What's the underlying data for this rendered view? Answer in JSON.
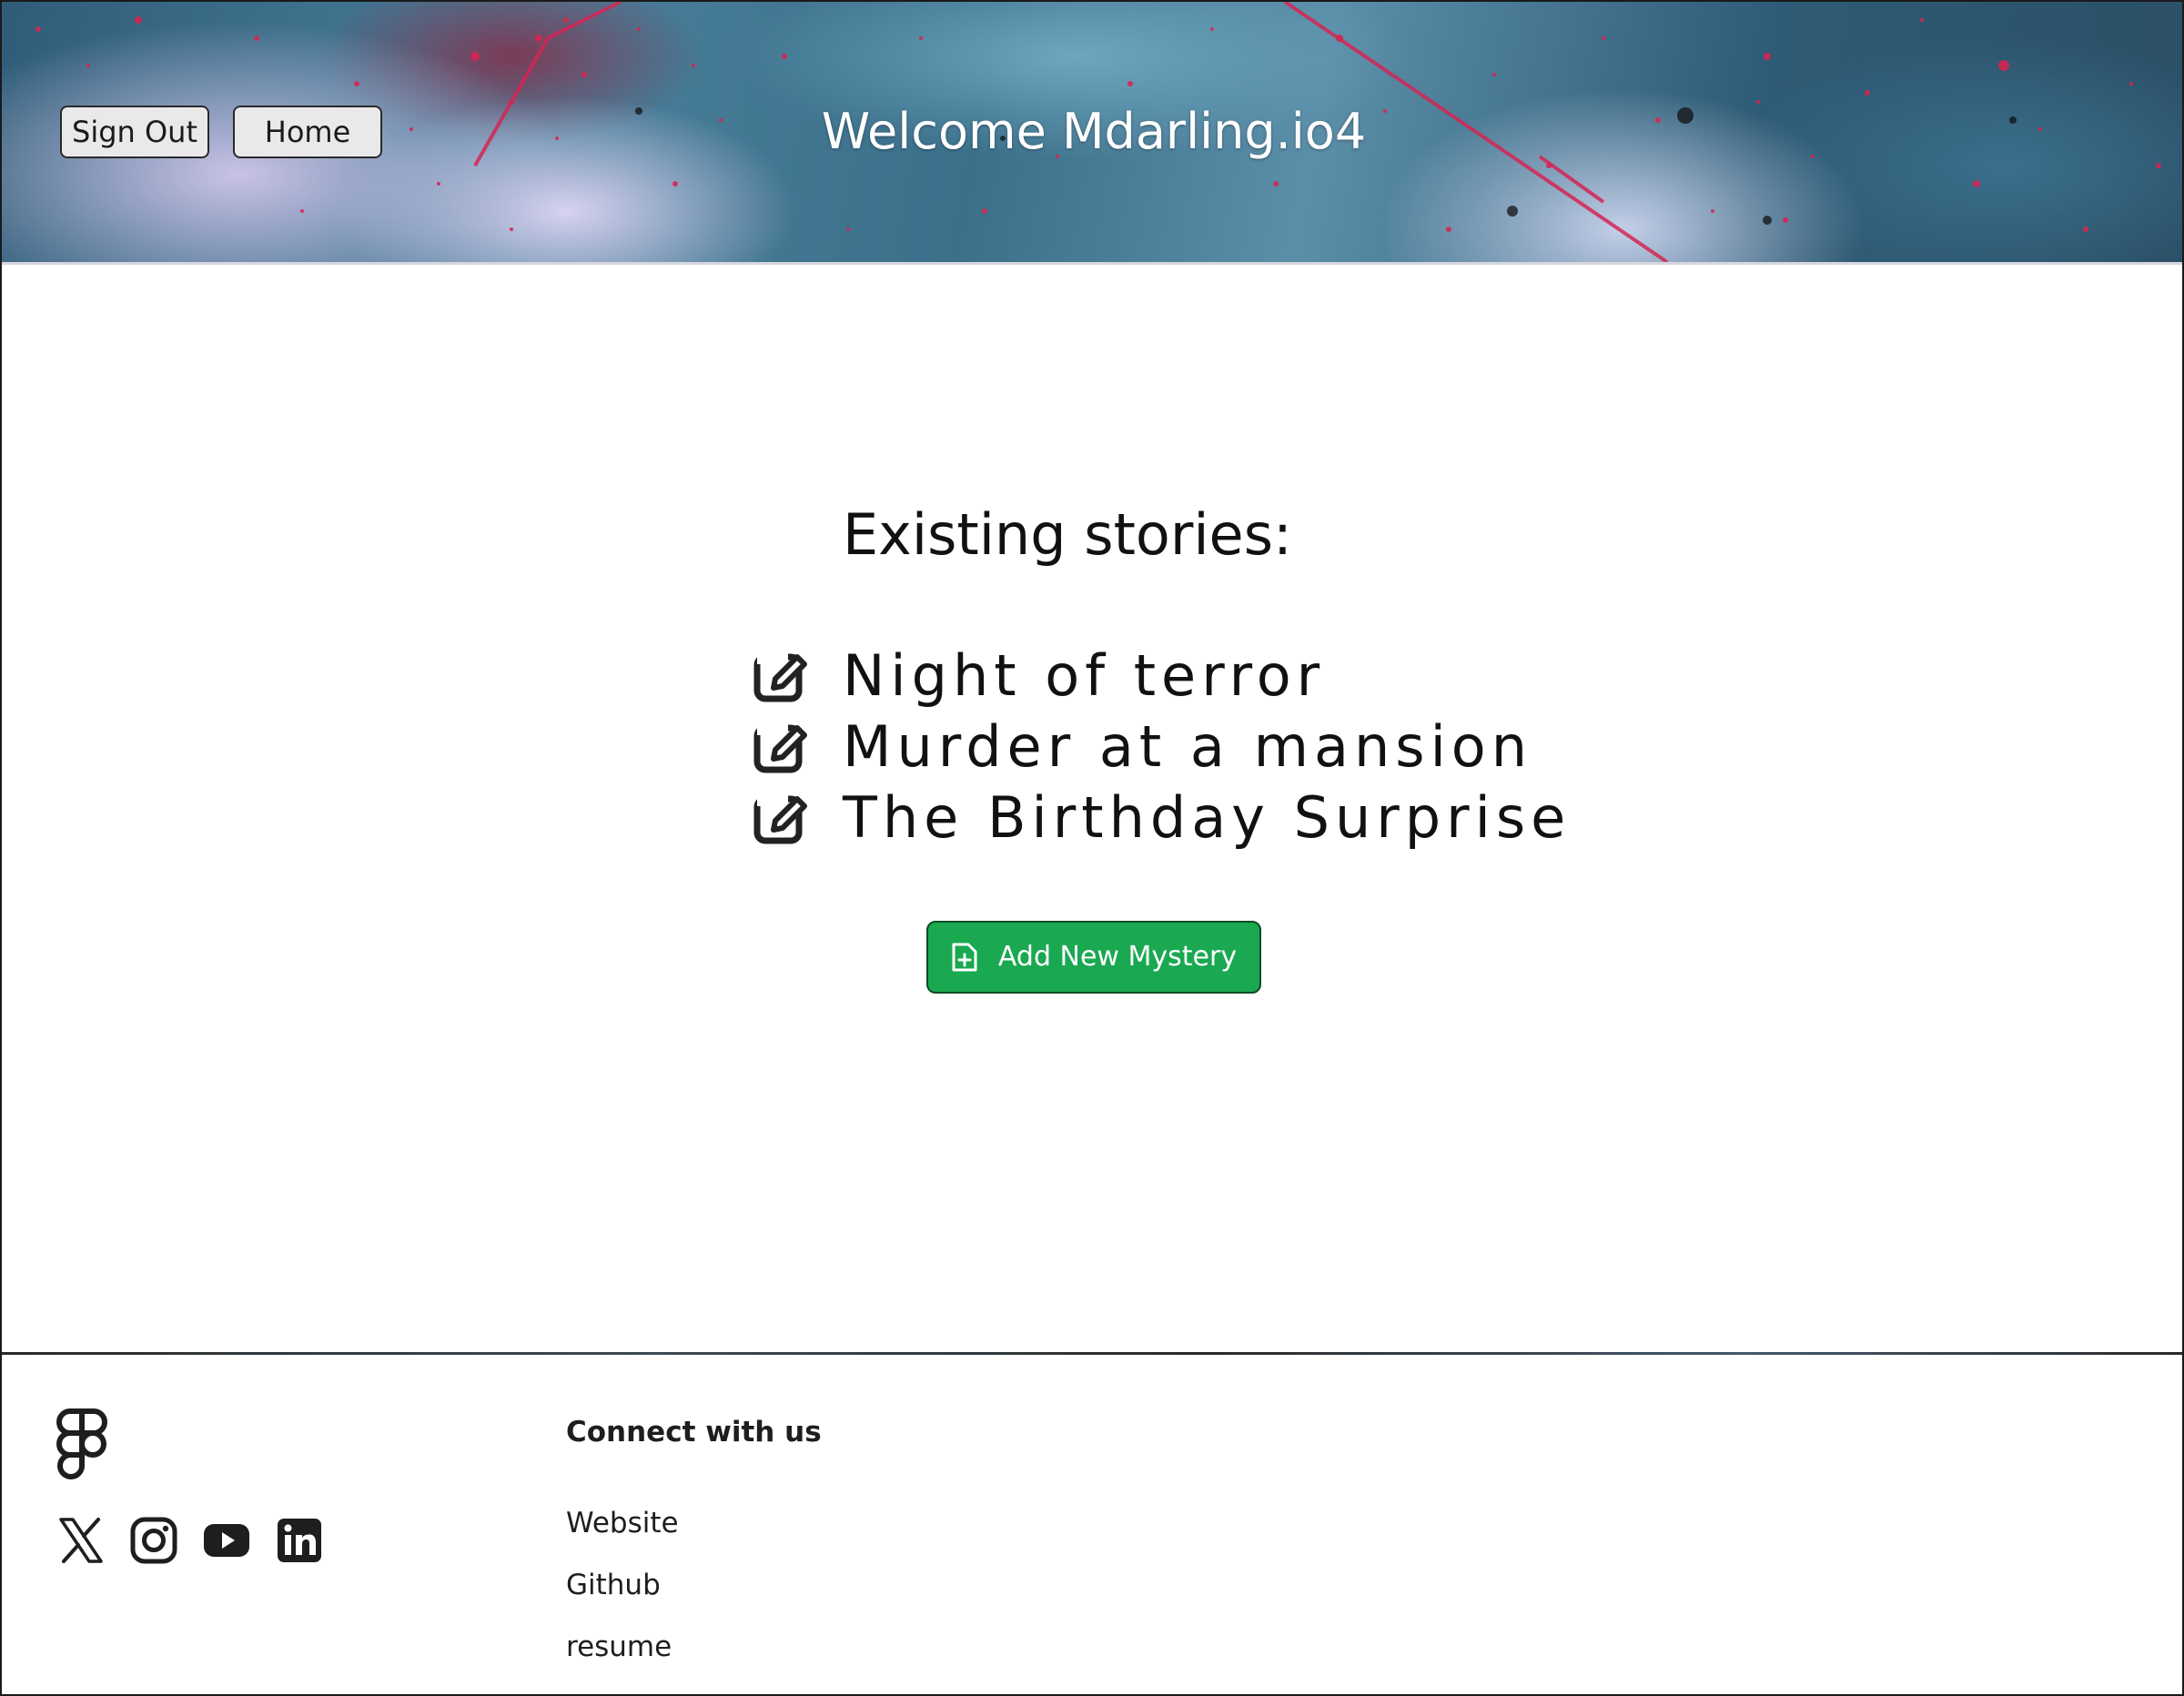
{
  "header": {
    "sign_out_label": "Sign Out",
    "home_label": "Home",
    "title": "Welcome Mdarling.io4"
  },
  "main": {
    "stories_heading": "Existing stories:",
    "stories": [
      {
        "title": "Night of terror",
        "icon": "edit-icon"
      },
      {
        "title": "Murder at a mansion",
        "icon": "edit-icon"
      },
      {
        "title": "The Birthday Surprise",
        "icon": "edit-icon"
      }
    ],
    "add_button_label": "Add New Mystery",
    "add_button_icon": "file-plus-icon"
  },
  "footer": {
    "logo_icon": "figma-logo-icon",
    "social_icons": [
      "x-icon",
      "instagram-icon",
      "youtube-icon",
      "linkedin-icon"
    ],
    "connect_heading": "Connect with us",
    "links": [
      "Website",
      "Github",
      "resume"
    ]
  },
  "colors": {
    "accent_green": "#1aa851",
    "text_dark": "#111111",
    "header_title": "#ffffff"
  }
}
